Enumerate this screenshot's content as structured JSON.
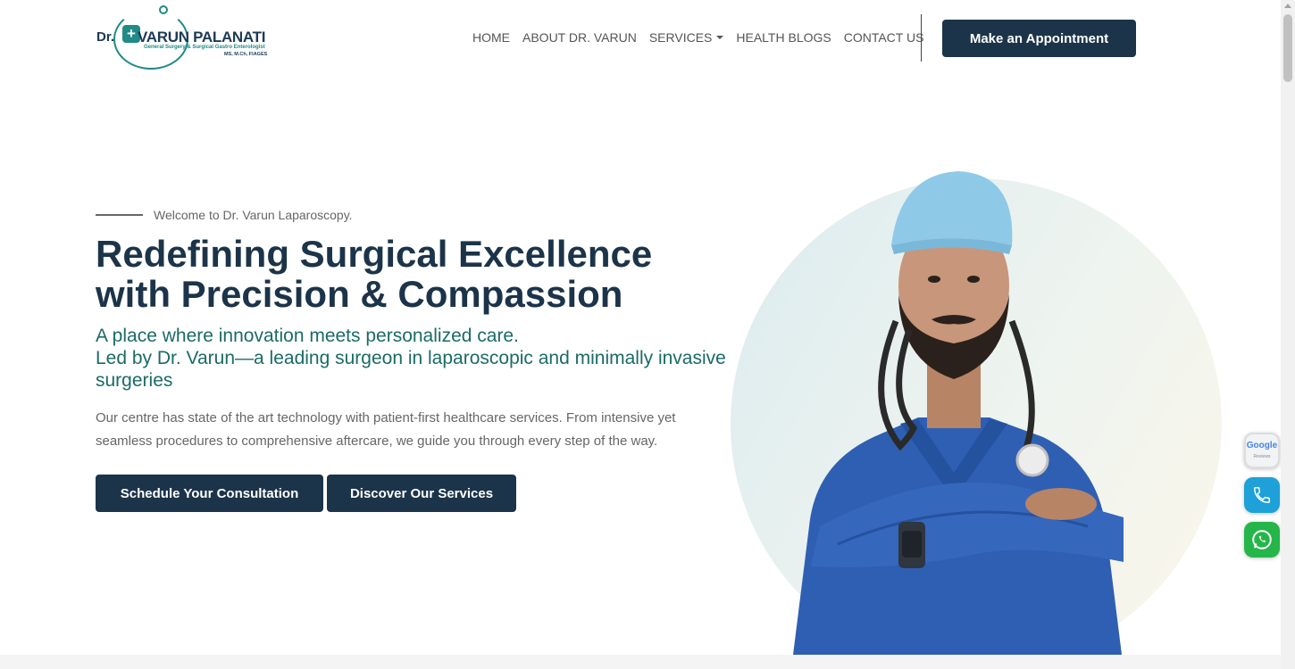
{
  "logo": {
    "prefix": "Dr.",
    "cross": "+",
    "name": "VARUN PALANATI",
    "subtitle": "General Surgery & Surgical Gastro Enterologist",
    "degrees": "MS, M.Ch, FIAGES"
  },
  "nav": {
    "items": [
      {
        "label": "HOME"
      },
      {
        "label": "ABOUT DR. VARUN"
      },
      {
        "label": "SERVICES"
      },
      {
        "label": "HEALTH BLOGS"
      },
      {
        "label": "CONTACT US"
      }
    ],
    "cta": "Make an Appointment"
  },
  "hero": {
    "welcome": "Welcome to Dr. Varun Laparoscopy.",
    "heading_line1": "Redefining Surgical Excellence",
    "heading_line2": "with Precision & Compassion",
    "sub_line1": "A place where innovation meets personalized care.",
    "sub_line2": "Led by Dr. Varun—a leading surgeon in laparoscopic and minimally invasive surgeries",
    "description": "Our centre has state of the art technology with patient-first healthcare services. From intensive yet seamless procedures to comprehensive aftercare, we guide you through every step of the way.",
    "button_primary": "Schedule Your Consultation",
    "button_secondary": "Discover Our Services"
  },
  "floating": {
    "google": "Google",
    "google_caption": "Reviews"
  },
  "colors": {
    "navy": "#1c3449",
    "teal": "#1a6b66",
    "scrubs": "#2f5fb3"
  },
  "icons": [
    "caret-down-icon",
    "phone-icon",
    "whatsapp-icon",
    "google-reviews-icon",
    "stethoscope-icon"
  ]
}
